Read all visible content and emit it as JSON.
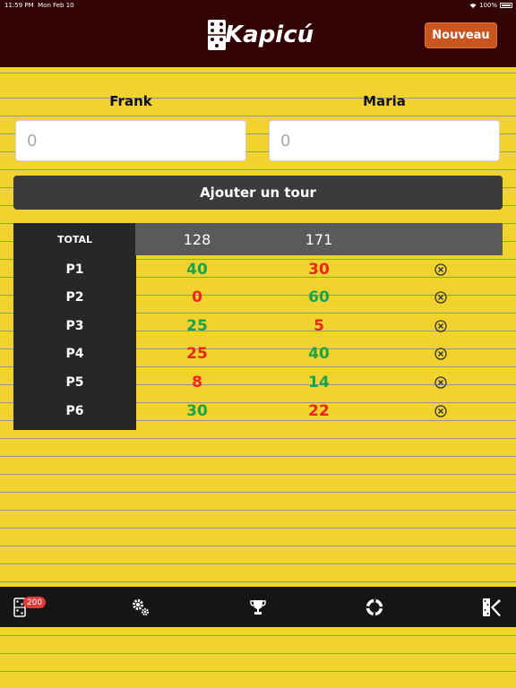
{
  "status": {
    "time": "11:59 PM",
    "date": "Mon Feb 10",
    "battery": "100%"
  },
  "header": {
    "logo_text": "Kapicú",
    "new_button": "Nouveau"
  },
  "players": [
    {
      "name": "Frank",
      "input_placeholder": "0"
    },
    {
      "name": "Maria",
      "input_placeholder": "0"
    }
  ],
  "add_round_label": "Ajouter un tour",
  "scoreboard": {
    "total_label": "TOTAL",
    "totals": [
      "128",
      "171"
    ],
    "rounds": [
      {
        "label": "P1",
        "scores": [
          "40",
          "30"
        ],
        "colors": [
          "#1aa34a",
          "#e8261c"
        ]
      },
      {
        "label": "P2",
        "scores": [
          "0",
          "60"
        ],
        "colors": [
          "#e8261c",
          "#1aa34a"
        ]
      },
      {
        "label": "P3",
        "scores": [
          "25",
          "5"
        ],
        "colors": [
          "#1aa34a",
          "#e8261c"
        ]
      },
      {
        "label": "P4",
        "scores": [
          "25",
          "40"
        ],
        "colors": [
          "#e8261c",
          "#1aa34a"
        ]
      },
      {
        "label": "P5",
        "scores": [
          "8",
          "14"
        ],
        "colors": [
          "#e8261c",
          "#1aa34a"
        ]
      },
      {
        "label": "P6",
        "scores": [
          "30",
          "22"
        ],
        "colors": [
          "#1aa34a",
          "#e8261c"
        ]
      }
    ]
  },
  "tabbar": {
    "badge": "200",
    "tabs": [
      "domino-icon",
      "settings-gears-icon",
      "trophy-icon",
      "lifebuoy-icon",
      "kapicu-logo-icon"
    ]
  },
  "colors": {
    "header_bg": "#330405",
    "accent": "#c9551f",
    "win": "#1aa34a",
    "lose": "#e8261c",
    "paper": "#f2d22e"
  }
}
